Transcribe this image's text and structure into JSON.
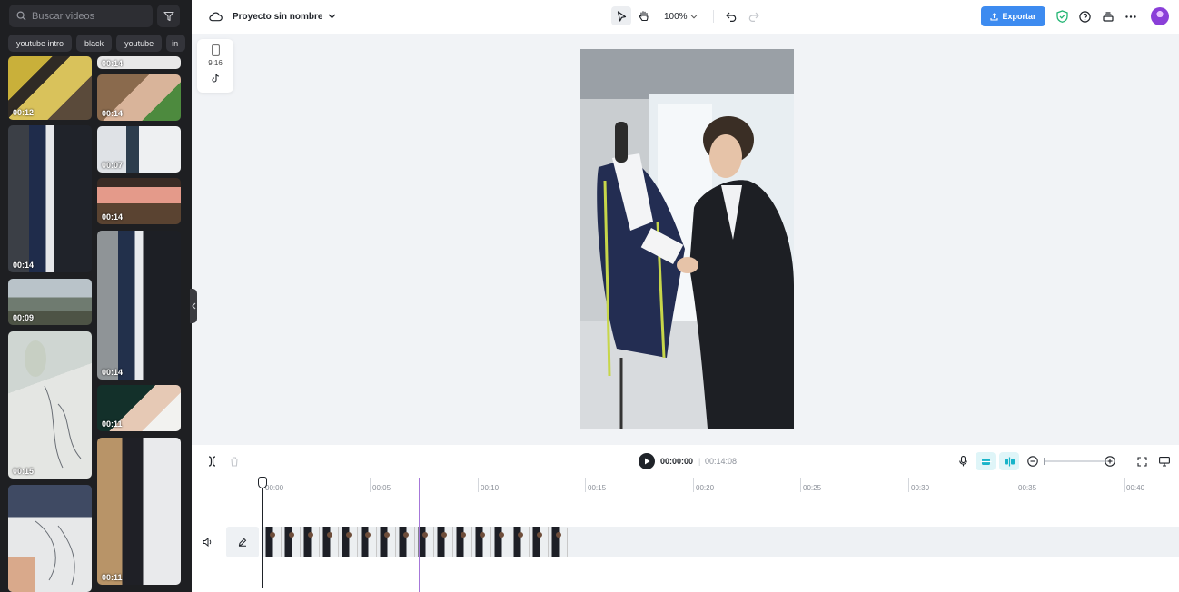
{
  "sidebar": {
    "search_placeholder": "Buscar videos",
    "chips": [
      "youtube intro",
      "black",
      "youtube",
      "in"
    ],
    "thumbnails": [
      {
        "duration": "00:12"
      },
      {
        "duration": "00:14"
      },
      {
        "duration": "00:09"
      },
      {
        "duration": "00:15"
      },
      {
        "duration": "00:14"
      },
      {
        "duration": "00:14"
      },
      {
        "duration": "00:07"
      },
      {
        "duration": "00:14"
      },
      {
        "duration": "00:14"
      },
      {
        "duration": "00:11"
      },
      {
        "duration": "00:11"
      }
    ]
  },
  "header": {
    "project_name": "Proyecto sin nombre",
    "zoom": "100%",
    "export_label": "Exportar"
  },
  "canvas": {
    "aspect_ratio": "9:16"
  },
  "timeline": {
    "current_time": "00:00:00",
    "separator": "|",
    "total_time": "00:14:08",
    "ruler": [
      "00:00",
      "00:05",
      "00:10",
      "00:15",
      "00:20",
      "00:25",
      "00:30",
      "00:35",
      "00:40"
    ]
  },
  "colors": {
    "accent": "#3d8bf0",
    "sidebar_bg": "#1e1f22",
    "shield": "#22b573",
    "magnet_active": "#18b4c9"
  }
}
